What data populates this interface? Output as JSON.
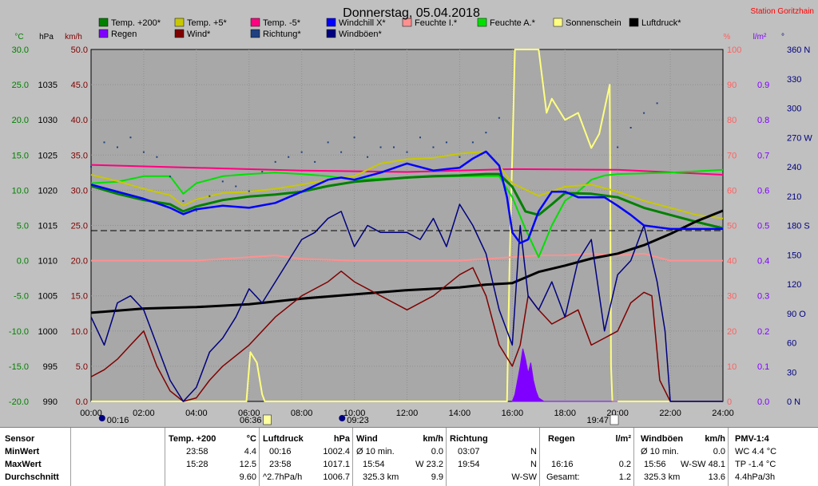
{
  "title": "Donnerstag, 05.04.2018",
  "station": "Station Goritzhain",
  "colors": {
    "temp200": "#008000",
    "temp5": "#c8c800",
    "tempm5": "#ff0080",
    "windchill": "#0000ff",
    "feuchte_i": "#ff9090",
    "feuchte_a": "#00e000",
    "sonne": "#ffff80",
    "luftdruck": "#000000",
    "regen": "#8000ff",
    "wind": "#800000",
    "richtung": "#204080",
    "windboeen": "#000080"
  },
  "axes": {
    "left_c": {
      "unit": "°C",
      "ticks": [
        "30.0",
        "25.0",
        "20.0",
        "15.0",
        "10.0",
        "5.0",
        "0.0",
        "-5.0",
        "-10.0",
        "-15.0",
        "-20.0"
      ]
    },
    "left_hpa": {
      "unit": "hPa",
      "ticks": [
        "1035",
        "1030",
        "1025",
        "1020",
        "1015",
        "1010",
        "1005",
        "1000",
        "995",
        "990"
      ]
    },
    "left_kmh": {
      "unit": "km/h",
      "ticks": [
        "50.0",
        "45.0",
        "40.0",
        "35.0",
        "30.0",
        "25.0",
        "20.0",
        "15.0",
        "10.0",
        "5.0",
        "0.0"
      ]
    },
    "right_pct": {
      "unit": "%",
      "ticks": [
        "100",
        "90",
        "80",
        "70",
        "60",
        "50",
        "40",
        "30",
        "20",
        "10",
        "0"
      ]
    },
    "right_lm2": {
      "unit": "l/m²",
      "ticks": [
        "0.9",
        "0.8",
        "0.7",
        "0.6",
        "0.5",
        "0.4",
        "0.3",
        "0.2",
        "0.1",
        "0.0"
      ]
    },
    "right_deg": {
      "unit": "°",
      "ticks": [
        "360 N",
        "330",
        "300",
        "270 W",
        "240",
        "210",
        "180 S",
        "150",
        "120",
        "90 O",
        "60",
        "30",
        "0 N"
      ]
    },
    "x_ticks": [
      "00:00",
      "02:00",
      "04:00",
      "06:00",
      "08:00",
      "10:00",
      "12:00",
      "14:00",
      "16:00",
      "18:00",
      "20:00",
      "22:00",
      "24:00"
    ]
  },
  "sun_markers": {
    "moon_set": "00:16",
    "sunrise": "06:36",
    "moon_rise": "09:23",
    "sunset": "19:47"
  },
  "chart_data": {
    "type": "line",
    "x_unit": "hours",
    "xlim": [
      0,
      24
    ],
    "legend": [
      "Temp. +200*",
      "Temp. +5*",
      "Temp. -5*",
      "Windchill X*",
      "Feuchte I.*",
      "Feuchte A.*",
      "Sonnenschein",
      "Luftdruck*",
      "Regen",
      "Wind*",
      "Richtung*",
      "Windböen*"
    ],
    "series": [
      {
        "name": "Temp. +200*",
        "axis": "C",
        "x": [
          0,
          1,
          2,
          3,
          3.5,
          4,
          5,
          6,
          7,
          8,
          9,
          10,
          12,
          13,
          14,
          15,
          15.5,
          16,
          16.5,
          17,
          17.5,
          18,
          19,
          20,
          21,
          22,
          23,
          24
        ],
        "y": [
          10.6,
          9.5,
          8.6,
          8,
          7,
          7.7,
          8.6,
          9.1,
          9.4,
          9.8,
          10.6,
          11.2,
          11.8,
          12.0,
          12.1,
          12.3,
          12.3,
          10.5,
          7,
          6.5,
          8,
          9.6,
          9.5,
          9,
          7.5,
          6.5,
          5.5,
          4.6
        ]
      },
      {
        "name": "Temp. +5*",
        "axis": "C",
        "x": [
          0,
          1,
          2,
          3,
          3.5,
          4,
          5,
          6,
          7,
          8,
          9,
          10,
          11,
          12,
          13,
          14,
          15,
          15.5,
          16,
          17,
          18,
          19,
          20,
          21,
          22,
          23,
          24
        ],
        "y": [
          12.2,
          11.3,
          10.2,
          9.3,
          7.8,
          8.7,
          9.6,
          9.8,
          10.2,
          10.8,
          11.5,
          12,
          13.8,
          14.4,
          14.6,
          15.2,
          15.5,
          13.5,
          11,
          9.2,
          10.5,
          10.8,
          9.8,
          8.5,
          7.5,
          6.5,
          6
        ]
      },
      {
        "name": "Temp. -5*",
        "axis": "C",
        "x": [
          0,
          4,
          8,
          12,
          16,
          20,
          24
        ],
        "y": [
          13.6,
          13.2,
          12.8,
          12.6,
          13.0,
          12.9,
          12.2
        ]
      },
      {
        "name": "Windchill X*",
        "axis": "C",
        "x": [
          0,
          1,
          2,
          3,
          3.5,
          4,
          5,
          6,
          7,
          8,
          9,
          9.5,
          10,
          11,
          12,
          13,
          13.5,
          14,
          14.5,
          15,
          15.5,
          15.8,
          16,
          16.3,
          16.6,
          17,
          17.5,
          18,
          18.5,
          19,
          19.5,
          20,
          20.5,
          21,
          22,
          24
        ],
        "y": [
          10.8,
          9.8,
          8.8,
          7.5,
          6.6,
          7.3,
          7.8,
          7.5,
          8.2,
          9.8,
          11.5,
          11.8,
          11.5,
          12.5,
          13.8,
          12.8,
          13,
          13.2,
          14.5,
          15.5,
          13.5,
          9,
          4,
          2.5,
          3,
          7,
          9.8,
          9.8,
          9,
          9,
          9,
          7.8,
          6.5,
          5,
          4.5,
          4.5
        ]
      },
      {
        "name": "Feuchte I.*",
        "axis": "pct",
        "x": [
          0,
          4,
          6,
          7,
          8,
          10,
          12,
          14,
          16,
          17,
          18,
          19,
          20,
          21,
          22,
          24
        ],
        "y": [
          40,
          40,
          41,
          41.5,
          40.5,
          40,
          40,
          40,
          41,
          41.5,
          41.5,
          42,
          41.5,
          42,
          40,
          40
        ]
      },
      {
        "name": "Feuchte A.*",
        "axis": "C",
        "x": [
          0,
          1,
          2,
          3,
          3.5,
          4,
          5,
          6,
          7,
          8,
          9,
          10,
          12,
          14,
          15.5,
          16,
          16.5,
          17,
          17.5,
          18,
          18.5,
          19,
          19.5,
          20,
          21,
          22,
          23,
          24
        ],
        "y": [
          11,
          11.2,
          12,
          12,
          9.5,
          11,
          12,
          12.3,
          12.5,
          12.3,
          12,
          11.5,
          11.8,
          12,
          12,
          9,
          4.5,
          0.5,
          5,
          8.5,
          9.8,
          11.5,
          12.1,
          12.3,
          12.4,
          12.5,
          12.7,
          12.9
        ]
      },
      {
        "name": "Sonnenschein",
        "axis": "pct",
        "x": [
          0,
          5.9,
          6.05,
          6.3,
          6.5,
          6.6,
          15.8,
          15.9,
          16.1,
          17,
          17.2,
          17.3,
          17.5,
          18,
          18.5,
          19,
          19.3,
          19.7,
          19.75,
          19.8,
          24
        ],
        "y": [
          0,
          0,
          14,
          11,
          2,
          0,
          0,
          40,
          100,
          100,
          88,
          82,
          86,
          80,
          82,
          72,
          76,
          90,
          10,
          0,
          0
        ]
      },
      {
        "name": "Luftdruck*",
        "axis": "hPa",
        "x": [
          0,
          2,
          4,
          6,
          8,
          10,
          12,
          14,
          15,
          16,
          17,
          18,
          19,
          20,
          21,
          22,
          23,
          24
        ],
        "y": [
          1002.6,
          1003.2,
          1003.4,
          1003.8,
          1004.6,
          1005.2,
          1005.8,
          1006.2,
          1006.6,
          1006.8,
          1008.4,
          1009.3,
          1010.3,
          1011,
          1012.2,
          1013.8,
          1015.6,
          1017.1
        ]
      },
      {
        "name": "Regen",
        "axis": "lm2",
        "x": [
          16,
          16.1,
          16.2,
          16.3,
          16.4,
          16.5,
          16.6,
          16.7,
          16.8,
          16.9,
          17,
          17.2,
          20
        ],
        "y": [
          0,
          0.02,
          0.06,
          0.1,
          0.15,
          0.12,
          0.08,
          0.11,
          0.06,
          0.03,
          0.01,
          0,
          0
        ]
      },
      {
        "name": "Wind*",
        "axis": "kmh",
        "x": [
          0,
          0.5,
          1,
          1.5,
          2,
          2.5,
          3,
          3.5,
          4,
          4.5,
          5,
          6,
          7,
          8,
          9,
          9.5,
          10,
          11,
          12,
          13,
          14,
          14.5,
          15,
          15.5,
          16,
          16.3,
          16.6,
          17,
          17.5,
          18,
          18.5,
          19,
          19.5,
          20,
          20.5,
          21,
          21.3,
          21.6,
          22,
          24
        ],
        "y": [
          3.5,
          4.5,
          6,
          8,
          10,
          5,
          1.5,
          0,
          0.5,
          3,
          5,
          8,
          12,
          15,
          17,
          18.5,
          17,
          15,
          13,
          15,
          18,
          19,
          15,
          8,
          5,
          8,
          15,
          13,
          11,
          12,
          13,
          8,
          9,
          10,
          14,
          15.5,
          15,
          3,
          0,
          0
        ]
      },
      {
        "name": "Richtung*",
        "axis": "deg",
        "x": [
          0,
          0.5,
          1,
          1.5,
          2,
          2.5,
          3,
          3.5,
          4,
          4.5,
          5,
          5.5,
          6,
          6.5,
          7,
          7.5,
          8,
          8.5,
          9,
          9.5,
          10,
          10.5,
          11,
          11.5,
          12,
          12.5,
          13,
          13.5,
          14,
          14.5,
          15,
          15.5,
          20,
          20.5,
          21,
          21.5
        ],
        "y": [
          240,
          265,
          260,
          270,
          255,
          250,
          230,
          205,
          195,
          210,
          225,
          220,
          215,
          235,
          245,
          250,
          255,
          245,
          265,
          255,
          270,
          250,
          260,
          260,
          255,
          270,
          260,
          265,
          250,
          265,
          275,
          290,
          260,
          280,
          295,
          305
        ]
      },
      {
        "name": "Windböen*",
        "axis": "kmh",
        "x": [
          0,
          0.5,
          1,
          1.5,
          2,
          2.5,
          3,
          3.5,
          4,
          4.5,
          5,
          5.5,
          6,
          6.5,
          7,
          7.5,
          8,
          8.5,
          9,
          9.5,
          10,
          10.5,
          11,
          11.5,
          12,
          12.5,
          13,
          13.5,
          14,
          14.5,
          15,
          15.5,
          16,
          16.3,
          16.6,
          17,
          17.5,
          18,
          18.5,
          19,
          19.5,
          20,
          20.5,
          21,
          21.5,
          21.8,
          22,
          24
        ],
        "y": [
          12,
          8,
          14,
          15,
          13,
          8,
          3,
          0,
          2,
          7,
          9,
          12,
          16,
          14,
          17,
          20,
          23,
          24,
          26,
          27,
          22,
          25,
          24,
          24,
          24,
          23,
          26,
          22,
          28,
          25,
          21,
          13,
          8,
          25,
          15,
          13,
          17,
          12,
          20,
          23,
          10,
          18,
          20,
          25,
          17,
          10,
          0,
          0
        ]
      }
    ]
  },
  "stats": {
    "rows": [
      "Sensor",
      "MinWert",
      "MaxWert",
      "Durchschnitt"
    ],
    "temp": {
      "title": "Temp. +200",
      "unit": "°C",
      "min_time": "23:58",
      "min": "4.4",
      "max_time": "15:28",
      "max": "12.5",
      "avg": "9.60"
    },
    "luftdruck": {
      "title": "Luftdruck",
      "unit": "hPa",
      "min_time": "00:16",
      "min": "1002.4",
      "max_time": "23:58",
      "max": "1017.1",
      "trend": "^2.7hPa/h",
      "avg": "1006.7"
    },
    "wind": {
      "title": "Wind",
      "unit": "km/h",
      "min_label": "Ø 10 min.",
      "min": "0.0",
      "max_time": "15:54",
      "max": "W 23.2",
      "dist": "325.3 km",
      "avg": "9.9"
    },
    "richtung": {
      "title": "Richtung",
      "min_time": "03:07",
      "min": "N",
      "max_time": "19:54",
      "max": "N",
      "avg": "W-SW"
    },
    "regen": {
      "title": "Regen",
      "unit": "l/m²",
      "max_time": "16:16",
      "max": "0.2",
      "total_label": "Gesamt:",
      "total": "1.2"
    },
    "windboeen": {
      "title": "Windböen",
      "unit": "km/h",
      "min_label": "Ø 10 min.",
      "min": "0.0",
      "max_time": "15:56",
      "max": "W-SW 48.1",
      "dist": "325.3 km",
      "avg": "13.6"
    },
    "pmv": {
      "title": "PMV-1:4",
      "wc": "WC 4.4 °C",
      "tp": "TP -1.4 °C",
      "rate": "4.4hPa/3h"
    }
  }
}
